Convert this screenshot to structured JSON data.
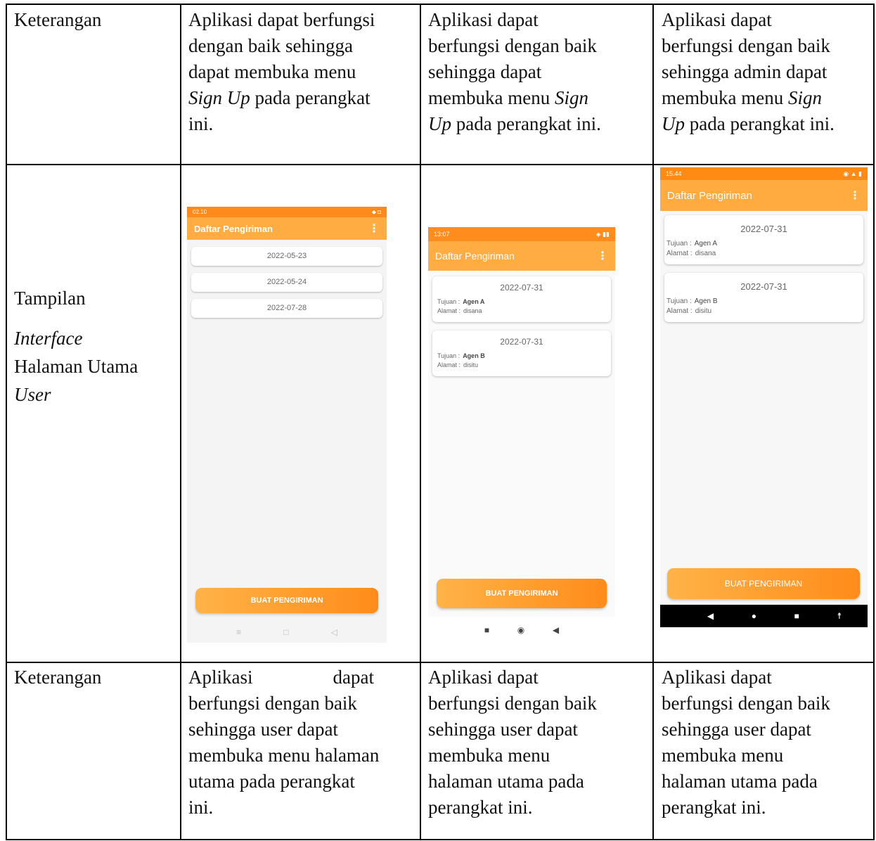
{
  "table": {
    "row1": {
      "label": "Keterangan",
      "cells": [
        {
          "l1": "Aplikasi dapat berfungsi",
          "l2": "dengan baik sehingga",
          "l3": "dapat membuka menu",
          "l4_it": "Sign Up",
          "l4": " pada perangkat",
          "l5": "ini."
        },
        {
          "l1": "Aplikasi dapat",
          "l2": "berfungsi dengan baik",
          "l3": "sehingga dapat",
          "l4": "membuka menu ",
          "l4_it": "Sign",
          "l5_it": "Up",
          "l5": " pada perangkat ini."
        },
        {
          "l1": "Aplikasi dapat",
          "l2": "berfungsi dengan baik",
          "l3": "sehingga admin dapat",
          "l4": "membuka menu ",
          "l4_it": "Sign",
          "l5_it": "Up",
          "l5": " pada perangkat ini."
        }
      ]
    },
    "row2": {
      "label_1": "Tampilan",
      "label_2": "Interface",
      "label_3": "Halaman Utama",
      "label_4": "User"
    },
    "row3": {
      "label": "Keterangan",
      "cells": [
        {
          "l1a": "Aplikasi",
          "l1b": "dapat",
          "l2": "berfungsi dengan baik",
          "l3": "sehingga user dapat",
          "l4": "membuka menu halaman",
          "l5": "utama pada perangkat",
          "l6": "ini."
        },
        {
          "l1": "Aplikasi dapat",
          "l2": "berfungsi dengan baik",
          "l3": "sehingga user dapat",
          "l4": "membuka menu",
          "l5": "halaman utama pada",
          "l6": "perangkat ini."
        },
        {
          "l1": "Aplikasi dapat",
          "l2": "berfungsi dengan baik",
          "l3": "sehingga user dapat",
          "l4": "membuka menu",
          "l5": "halaman utama pada",
          "l6": "perangkat ini."
        }
      ]
    }
  },
  "phones": {
    "p1": {
      "time": "02.10",
      "title": "Daftar Pengiriman",
      "menu": "⋮",
      "dates": [
        "2022-05-23",
        "2022-05-24",
        "2022-07-28"
      ],
      "button": "BUAT PENGIRIMAN",
      "nav": [
        "≡",
        "□",
        "◁"
      ]
    },
    "p2": {
      "time": "13:07",
      "title": "Daftar Pengiriman",
      "menu": "⋮",
      "cards": [
        {
          "date": "2022-07-31",
          "tujuan_label": "Tujuan :",
          "tujuan": "Agen A",
          "alamat_label": "Alamat :",
          "alamat": "disana"
        },
        {
          "date": "2022-07-31",
          "tujuan_label": "Tujuan :",
          "tujuan": "Agen B",
          "alamat_label": "Alamat :",
          "alamat": "disitu"
        }
      ],
      "button": "BUAT PENGIRIMAN",
      "nav": [
        "■",
        "◉",
        "◀"
      ]
    },
    "p3": {
      "time": "15.44",
      "title": "Daftar Pengiriman",
      "menu": "⋮",
      "cards": [
        {
          "date": "2022-07-31",
          "tujuan_label": "Tujuan :",
          "tujuan": "Agen A",
          "alamat_label": "Alamat :",
          "alamat": "disana"
        },
        {
          "date": "2022-07-31",
          "tujuan_label": "Tujuan :",
          "tujuan": "Agen B",
          "alamat_label": "Alamat :",
          "alamat": "disitu"
        }
      ],
      "button": "BUAT PENGIRIMAN",
      "nav": [
        "◀",
        "●",
        "■",
        "☨"
      ]
    }
  },
  "colors": {
    "orange": "#ff8f1f",
    "orange_light": "#ffab40",
    "border": "#000000"
  }
}
